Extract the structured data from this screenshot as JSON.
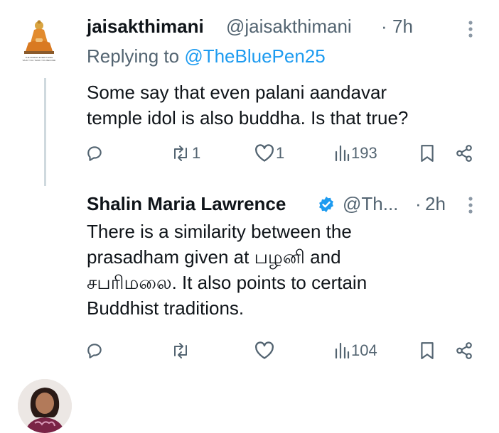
{
  "tweets": [
    {
      "author_name": "jaisakthimani",
      "handle": "@jaisakthimani",
      "separator": "·",
      "time": "7h",
      "replying_label": "Replying to ",
      "replying_handle": "@TheBluePen25",
      "text_lines": [
        "Some say that even palani aandavar",
        "temple idol is also buddha. Is that true?"
      ],
      "avatar_caption": "THE MINDSS EVERYTHING\nWHAT YOU THINK YOU BECOME",
      "actions": {
        "replies": "",
        "reposts": "1",
        "likes": "1",
        "views": "193"
      }
    },
    {
      "author_name": "Shalin Maria Lawrence",
      "handle": "@Th...",
      "separator": "·",
      "time": "2h",
      "verified": true,
      "text_lines": [
        "There is a similarity between the",
        "prasadham given at பழனி and",
        "சபரிமலை. It also points to certain",
        "Buddhist traditions."
      ],
      "actions": {
        "replies": "",
        "reposts": "",
        "likes": "",
        "views": "104"
      }
    }
  ],
  "colors": {
    "text": "#0f1419",
    "secondary": "#536471",
    "link": "#1d9bf0",
    "verified": "#1d9bf0",
    "thread_line": "#cfd9de"
  },
  "icons": [
    "reply-icon",
    "repost-icon",
    "like-icon",
    "views-icon",
    "bookmark-icon",
    "share-icon",
    "more-icon",
    "verified-badge-icon"
  ]
}
